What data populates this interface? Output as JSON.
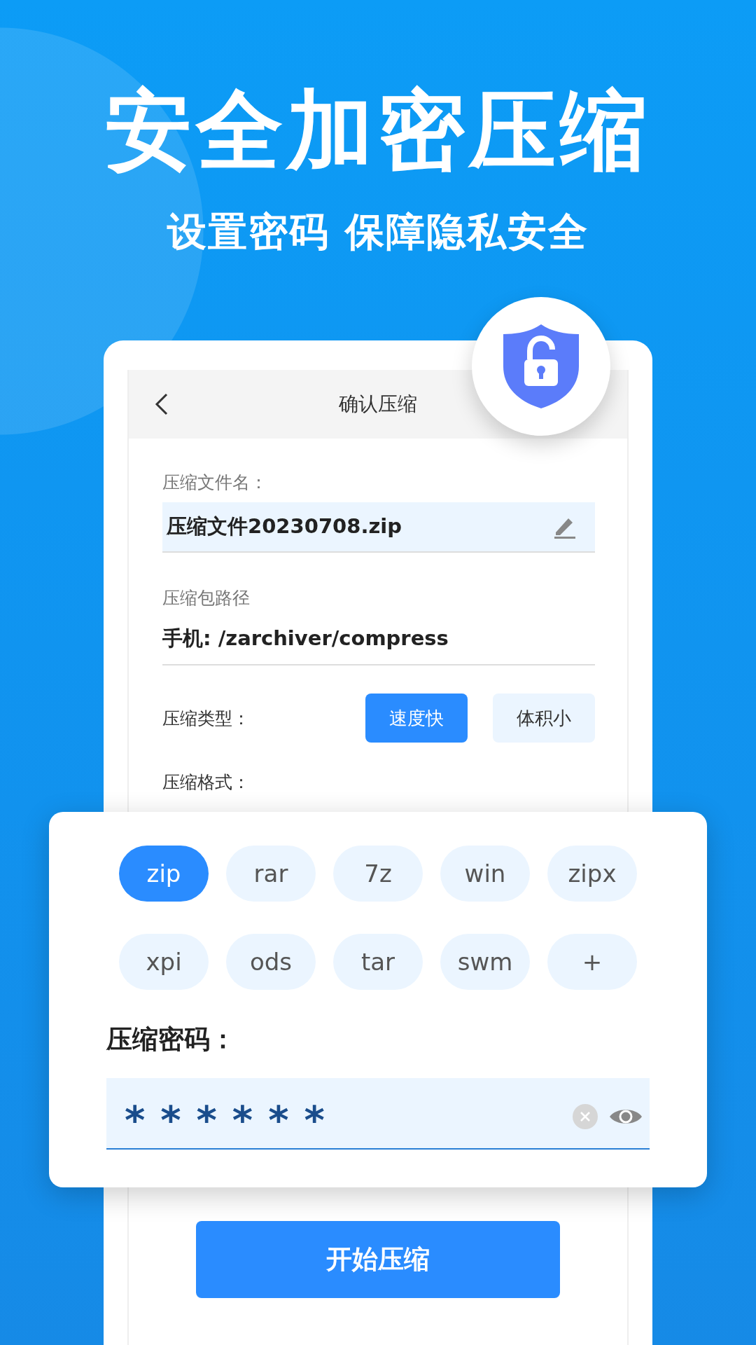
{
  "headline": "安全加密压缩",
  "subheadline": "设置密码 保障隐私安全",
  "screen": {
    "title": "确认压缩",
    "file_name": {
      "label": "压缩文件名：",
      "value": "压缩文件20230708.zip"
    },
    "path": {
      "label": "压缩包路径",
      "value": "手机: /zarchiver/compress"
    },
    "type": {
      "label": "压缩类型：",
      "options": [
        {
          "label": "速度快",
          "selected": true
        },
        {
          "label": "体积小",
          "selected": false
        }
      ]
    },
    "format": {
      "label": "压缩格式：",
      "options": [
        {
          "label": "zip",
          "selected": true
        },
        {
          "label": "rar",
          "selected": false
        },
        {
          "label": "7z",
          "selected": false
        },
        {
          "label": "win",
          "selected": false
        },
        {
          "label": "zipx",
          "selected": false
        },
        {
          "label": "xpi",
          "selected": false
        },
        {
          "label": "ods",
          "selected": false
        },
        {
          "label": "tar",
          "selected": false
        },
        {
          "label": "swm",
          "selected": false
        },
        {
          "label": "+",
          "selected": false
        }
      ]
    },
    "password": {
      "label": "压缩密码：",
      "value": "******"
    },
    "start_button": "开始压缩"
  }
}
